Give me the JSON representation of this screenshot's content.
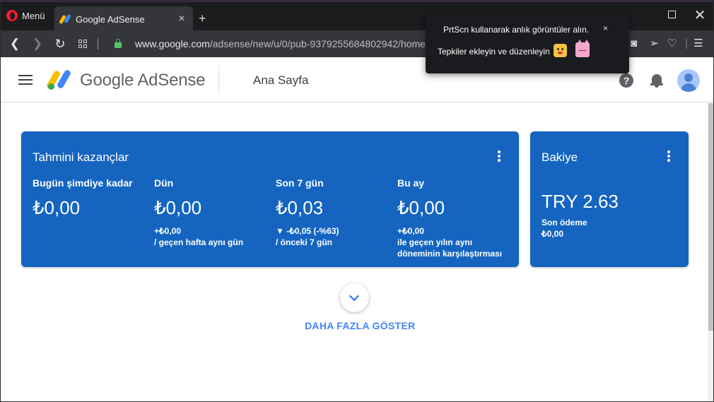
{
  "browser": {
    "menu_label": "Menü",
    "tab_title": "Google AdSense",
    "url_host": "www.google.com",
    "url_path": "/adsense/new/u/0/pub-9379255684802942/home",
    "new_tab_symbol": "+",
    "tab_close_symbol": "×"
  },
  "popup": {
    "line1": "PrtScn kullanarak anlık görüntüler alın.",
    "line2": "Tepkiler ekleyin ve düzenleyin",
    "close_symbol": "×"
  },
  "header": {
    "logo_text": "Google AdSense",
    "page_title": "Ana Sayfa",
    "help_symbol": "?"
  },
  "earnings": {
    "title": "Tahmini kazançlar",
    "metrics": [
      {
        "label": "Bugün şimdiye kadar",
        "value": "₺0,00",
        "delta1": "",
        "delta2": ""
      },
      {
        "label": "Dün",
        "value": "₺0,00",
        "delta1": "+₺0,00",
        "delta2": "/ geçen hafta aynı gün"
      },
      {
        "label": "Son 7 gün",
        "value": "₺0,03",
        "delta1": "▼ -₺0,05 (-%63)",
        "delta2": "/ önceki 7 gün"
      },
      {
        "label": "Bu ay",
        "value": "₺0,00",
        "delta1": "+₺0,00",
        "delta2": "ile geçen yılın aynı döneminin karşılaştırması"
      }
    ]
  },
  "balance": {
    "title": "Bakiye",
    "value": "TRY 2.63",
    "last_payment_label": "Son ödeme",
    "last_payment_value": "₺0,00"
  },
  "show_more_label": "DAHA FAZLA GÖSTER",
  "colors": {
    "card_blue": "#1565c0",
    "link_blue": "#4285f4",
    "logo_yellow": "#fbbc04",
    "logo_blue": "#4285f4",
    "logo_green": "#34a853"
  }
}
